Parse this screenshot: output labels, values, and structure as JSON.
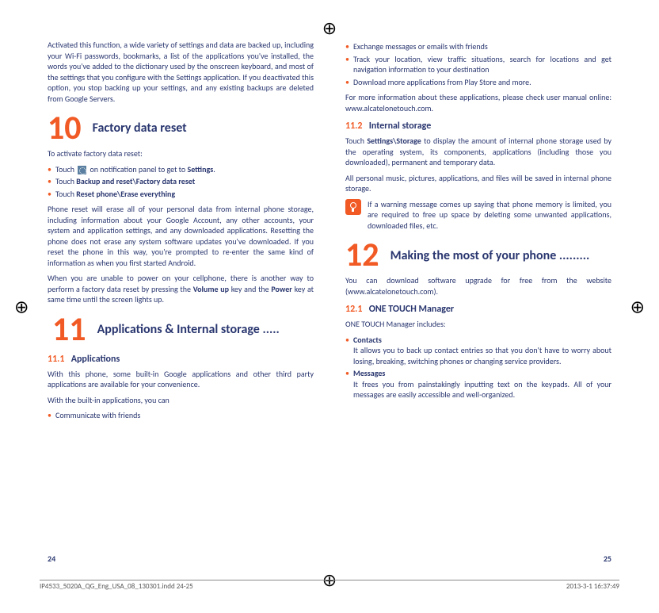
{
  "left": {
    "intro": "Activated this function, a wide variety of settings and data are backed up, including your Wi-Fi passwords, bookmarks, a list of the applications you've installed, the words you've added to the dictionary used by the onscreen keyboard, and most of the settings that you configure with the Settings application. If you deactivated this option, you stop backing up your settings, and any existing backups are deleted from Google Servers.",
    "sec10": {
      "num": "10",
      "title": "Factory data reset",
      "lead": "To activate factory data reset:",
      "b1a": "Touch ",
      "b1b": " on notification panel to get to ",
      "b1c": "Settings",
      "b1d": ".",
      "b2a": "Touch ",
      "b2b": "Backup and reset\\Factory data reset",
      "b3a": "Touch ",
      "b3b": "Reset phone\\Erase everything",
      "p1": "Phone reset will erase all of your personal data from internal phone storage, including information about your Google Account, any other accounts, your system and application settings, and any downloaded applications. Resetting the phone does not erase any system software updates you've downloaded. If you reset the phone in this way, you're prompted to re-enter the same kind of information as when you first started Android.",
      "p2a": "When you are unable to power on your cellphone, there is another way to perform a factory data reset by pressing the ",
      "p2b": "Volume up",
      "p2c": " key and the ",
      "p2d": "Power",
      "p2e": " key at same time until the screen lights up."
    },
    "sec11": {
      "num": "11",
      "title": "Applications & Internal storage .....",
      "s1num": "11.1",
      "s1title": "Applications",
      "p1": "With this phone, some built-in Google applications and other third party applications are available for your convenience.",
      "p2": "With the built-in applications, you can",
      "b1": "Communicate with friends"
    }
  },
  "right": {
    "bullets_top": {
      "b1": "Exchange messages or emails with friends",
      "b2": "Track your location, view traffic situations, search for locations and get navigation information to your destination",
      "b3": "Download more applications from Play Store and more."
    },
    "p_more": "For more information about these applications, please check user manual  online: www.alcatelonetouch.com.",
    "s2num": "11.2",
    "s2title": "Internal storage",
    "s2p1a": "Touch ",
    "s2p1b": "Settings\\Storage",
    "s2p1c": " to display the amount of internal phone storage used by the operating system, its components, applications (including those you downloaded), permanent and temporary data.",
    "s2p2": "All personal music, pictures, applications, and files will be saved in internal phone storage.",
    "tip": "If a warning message comes up saying that phone memory is limited, you are required to free up space by deleting some unwanted applications, downloaded files, etc.",
    "sec12": {
      "num": "12",
      "title": "Making the most of your phone .........",
      "p1": "You can download software upgrade for free from the website (www.alcatelonetouch.com).",
      "s1num": "12.1",
      "s1title": "ONE TOUCH Manager",
      "lead": "ONE TOUCH Manager includes:",
      "b1t": "Contacts",
      "b1d": "It allows you to back up contact entries so that you don't have to worry about losing, breaking, switching phones or changing service providers.",
      "b2t": "Messages",
      "b2d": "It frees you from painstakingly inputting text on the keypads. All of your messages are easily accessible and well-organized."
    }
  },
  "page_left": "24",
  "page_right": "25",
  "footer_left": "IP4533_5020A_QG_Eng_USA_08_130301.indd   24-25",
  "footer_right": "2013-3-1   16:37:49"
}
